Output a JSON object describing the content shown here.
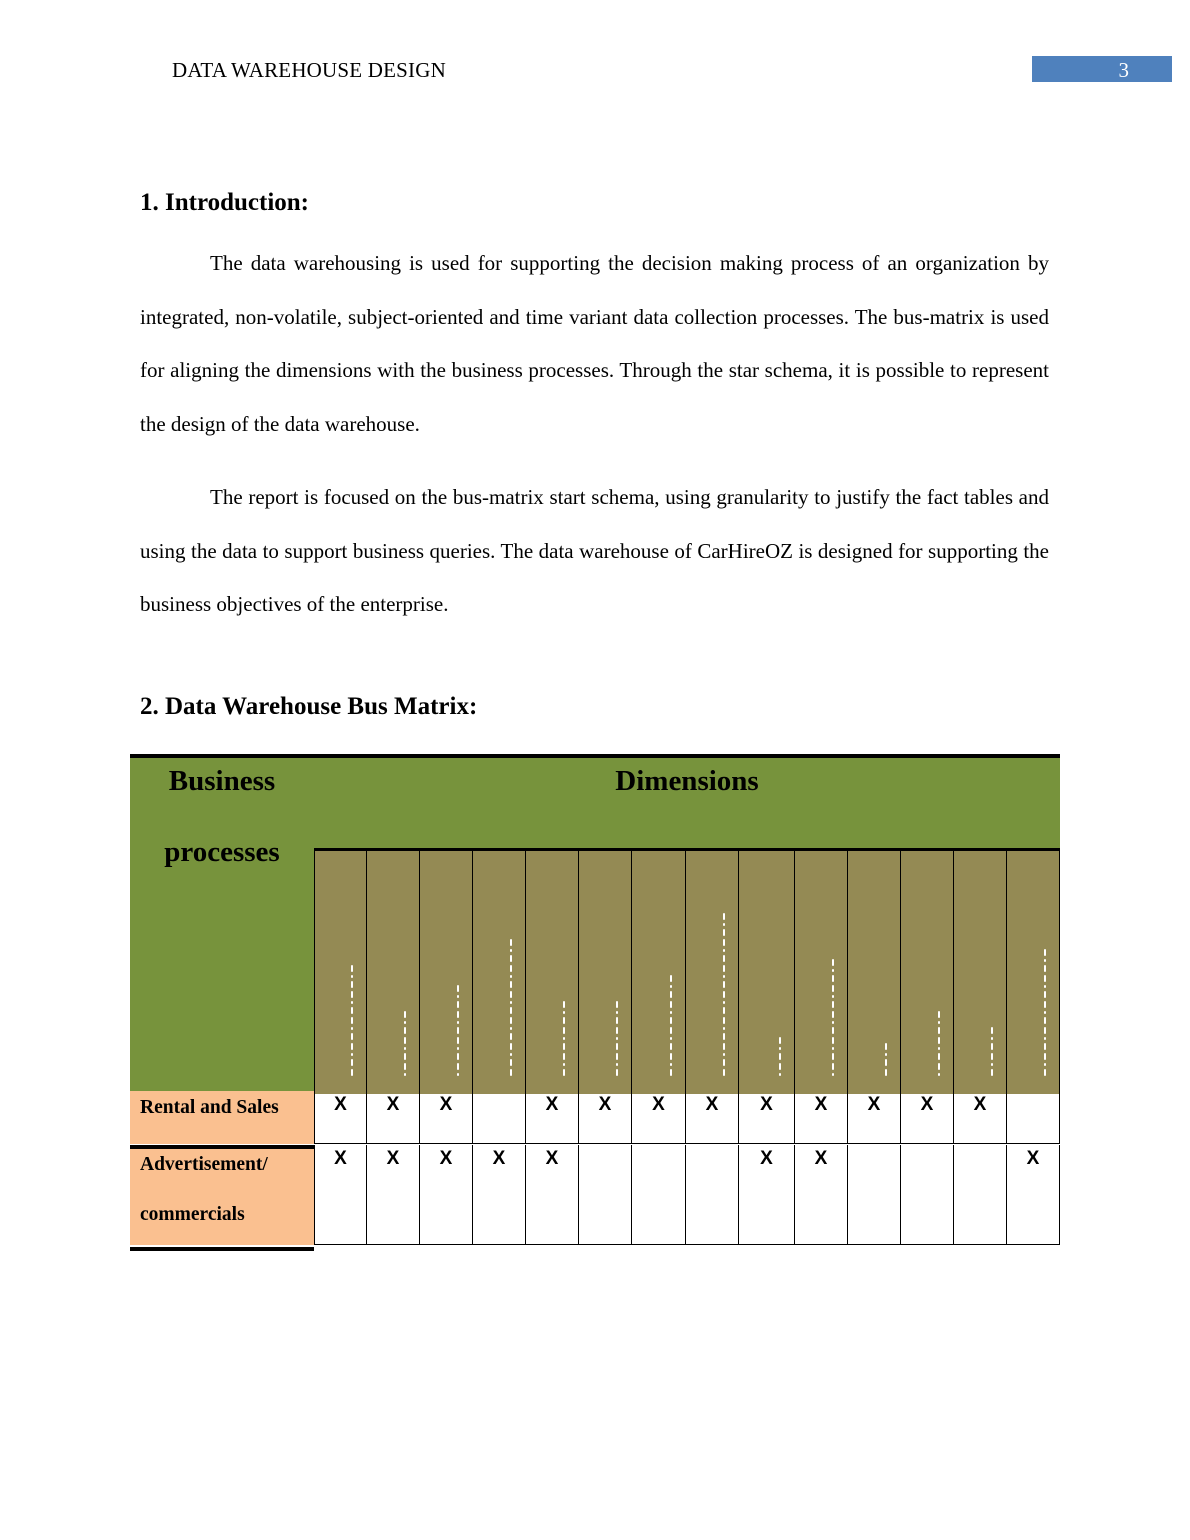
{
  "header": {
    "running_title": "DATA WAREHOUSE DESIGN",
    "page_number": "3",
    "accent_color": "#4f81bd"
  },
  "sections": [
    {
      "heading": "1. Introduction:",
      "paragraphs": [
        "The data warehousing is used for supporting the decision making process of an organization by integrated, non-volatile, subject-oriented and time variant data collection processes. The bus-matrix is used for aligning the dimensions with the business processes. Through the star schema, it is possible to represent the design of the data warehouse.",
        "The report is focused on the bus-matrix start schema, using granularity to justify the fact tables and using the data to support business queries. The data warehouse of CarHireOZ is designed for supporting the business objectives of the enterprise."
      ]
    },
    {
      "heading": "2. Data Warehouse Bus Matrix:"
    }
  ],
  "bus_matrix": {
    "row_header": [
      "Business",
      "processes"
    ],
    "column_group_header": "Dimensions",
    "dimension_labels_note": "14 rotated dimension labels (illegible in rendering)",
    "dimension_count": 14,
    "colors": {
      "header_green": "#77933c",
      "dimension_olive": "#948a54",
      "process_peach": "#fac090"
    },
    "rows": [
      {
        "process": "Rental and Sales",
        "marks": [
          "X",
          "X",
          "X",
          "",
          "X",
          "X",
          "X",
          "X",
          "X",
          "X",
          "X",
          "X",
          "X",
          ""
        ]
      },
      {
        "process": "Advertisement/ commercials",
        "process_lines": [
          "Advertisement/",
          "commercials"
        ],
        "marks": [
          "X",
          "X",
          "X",
          "X",
          "X",
          "",
          "",
          "",
          "X",
          "X",
          "",
          "",
          "",
          "X"
        ]
      }
    ]
  }
}
